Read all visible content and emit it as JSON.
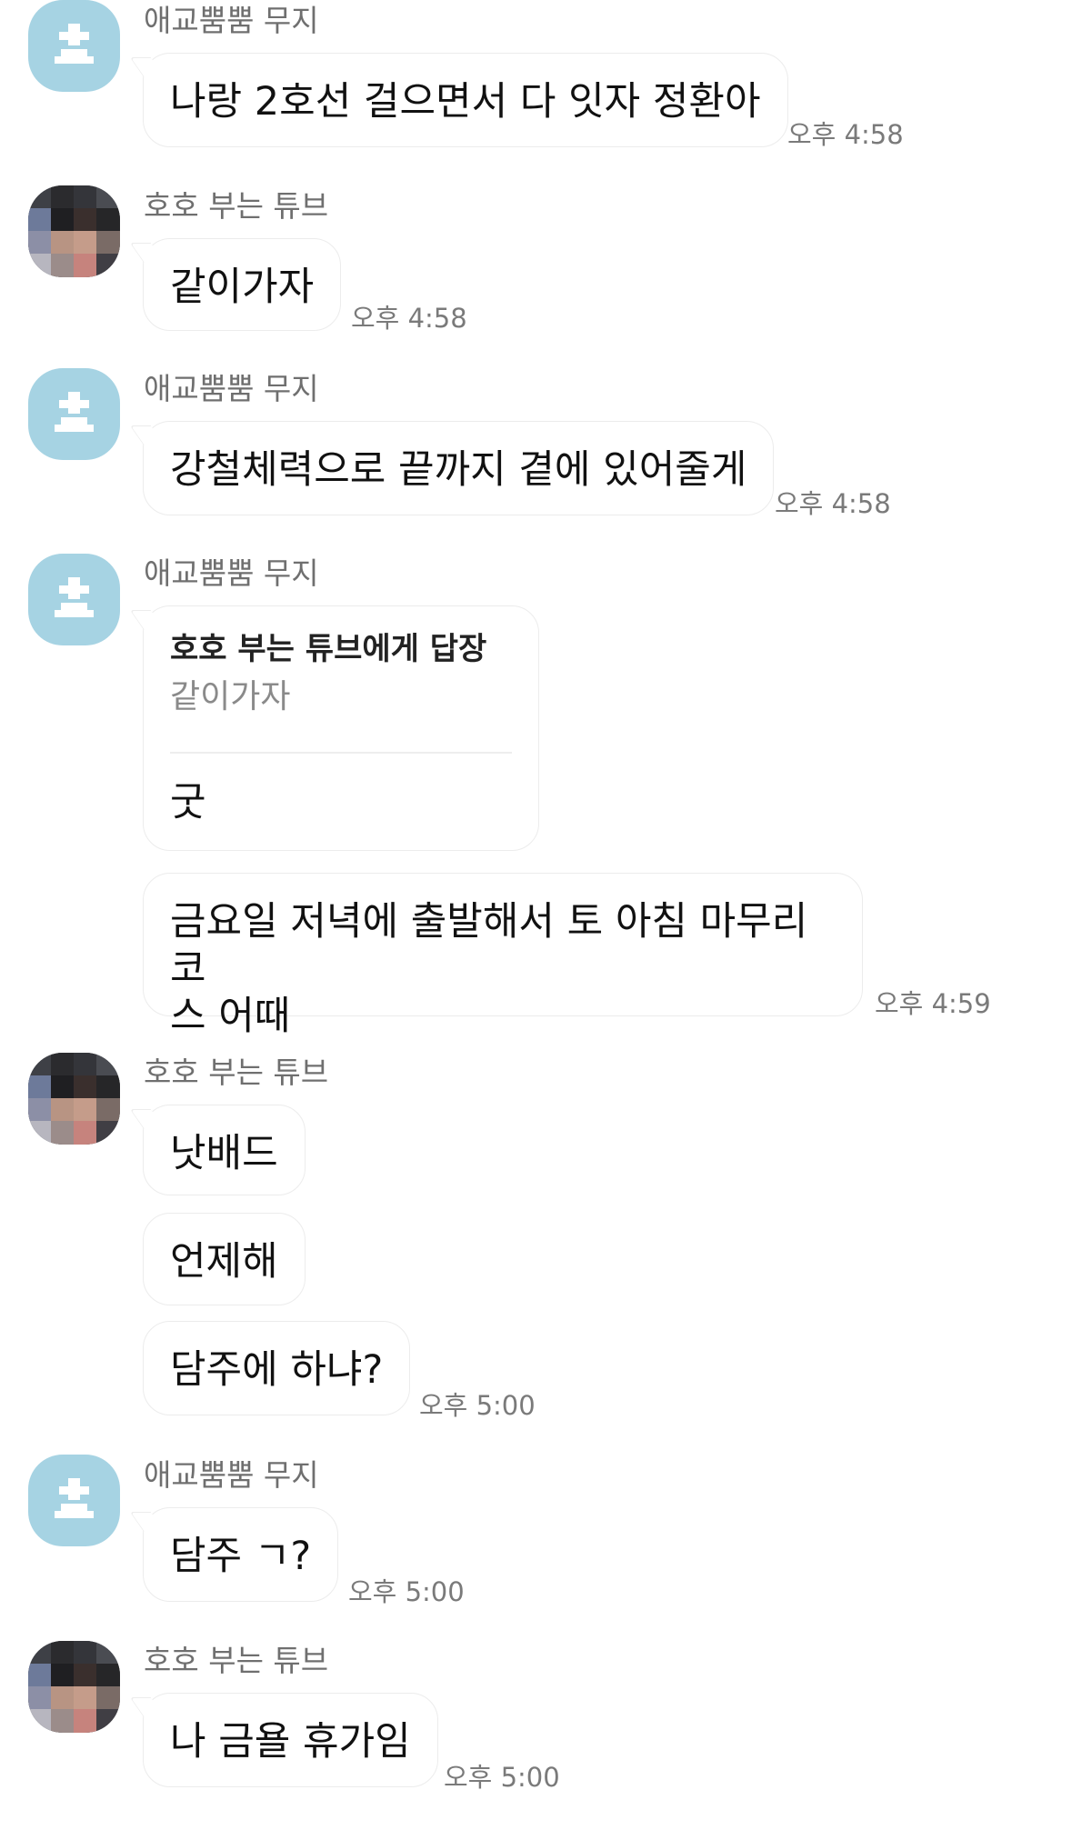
{
  "senders": {
    "muji": "애교뿜뿜 무지",
    "tube": "호호 부는 튜브"
  },
  "messages": {
    "m1": {
      "text": "나랑 2호선 걸으면서 다 잇자 정환아",
      "time": "오후 4:58"
    },
    "m2": {
      "text": "같이가자",
      "time": "오후 4:58"
    },
    "m3": {
      "text": "강철체력으로 끝까지 곁에 있어줄게",
      "time": "오후 4:58"
    },
    "m4": {
      "reply_title": "호호 부는 튜브에게 답장",
      "reply_quote": "같이가자",
      "text": "굿"
    },
    "m5": {
      "line1": "금요일 저녁에 출발해서 토 아침 마무리 코",
      "line2": "스 어때",
      "time": "오후 4:59"
    },
    "m6": {
      "text": "낫배드"
    },
    "m7": {
      "text": "언제해"
    },
    "m8": {
      "text": "담주에 하냐?",
      "time": "오후 5:00"
    },
    "m9": {
      "text": "담주 ㄱ?",
      "time": "오후 5:00"
    },
    "m10": {
      "text": "나 금욜 휴가임",
      "time": "오후 5:00"
    }
  },
  "colors": {
    "default_avatar": "#a6d3e3",
    "bubble_border": "#ececec",
    "meta_text": "#7a7a7a"
  },
  "icons": {
    "default_avatar": "default-profile-icon",
    "photo_avatar": "pixelated-profile-photo"
  }
}
